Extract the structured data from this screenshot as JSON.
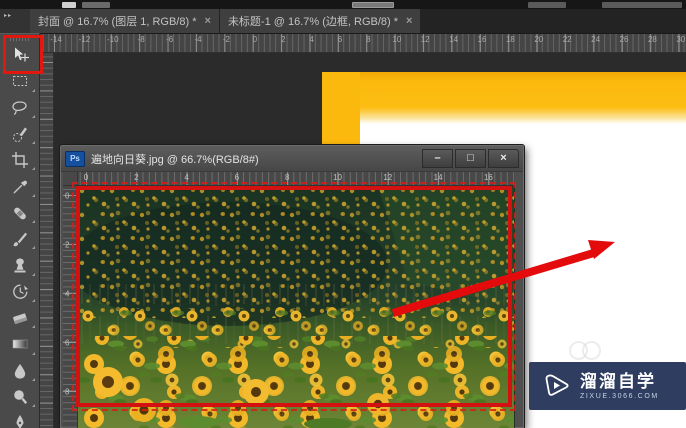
{
  "tab_bar": {
    "collapse_icon": "▸▸",
    "tabs": [
      {
        "label": "封面 @ 16.7% (图层 1, RGB/8) *",
        "close": "×"
      },
      {
        "label": "未标题-1 @ 16.7% (边框, RGB/8) *",
        "close": "×"
      }
    ]
  },
  "toolbar": {
    "selected_tool": "move",
    "tools": [
      "move",
      "rectangular-marquee",
      "lasso",
      "quick-selection",
      "crop",
      "eyedropper",
      "spot-healing-brush",
      "brush",
      "clone-stamp",
      "history-brush",
      "eraser",
      "gradient",
      "blur",
      "dodge",
      "pen"
    ]
  },
  "document_ruler": {
    "h_labels": [
      "-14",
      "-12",
      "-10",
      "-8",
      "-6",
      "-4",
      "-2",
      "0",
      "2",
      "4",
      "6",
      "8",
      "10",
      "12",
      "14",
      "16",
      "18",
      "20",
      "22",
      "24",
      "26",
      "28",
      "30"
    ]
  },
  "floating_window": {
    "icon_text": "Ps",
    "title": "遍地向日葵.jpg @ 66.7%(RGB/8#)",
    "controls": {
      "minimize": "–",
      "maximize": "□",
      "close": "×"
    },
    "ruler": {
      "h_labels": [
        "0",
        "2",
        "4",
        "6",
        "8",
        "10",
        "12",
        "14",
        "16"
      ],
      "v_labels": [
        "0",
        "2",
        "4",
        "6",
        "8"
      ]
    }
  },
  "watermark": {
    "brand": "溜溜自学",
    "domain": "ZIXUE.3066.COM",
    "play_icon": "play-button"
  },
  "colors": {
    "accent_yellow": "#fcb90d",
    "annotation_red": "#d31111",
    "watermark_navy": "#2e3d60"
  }
}
